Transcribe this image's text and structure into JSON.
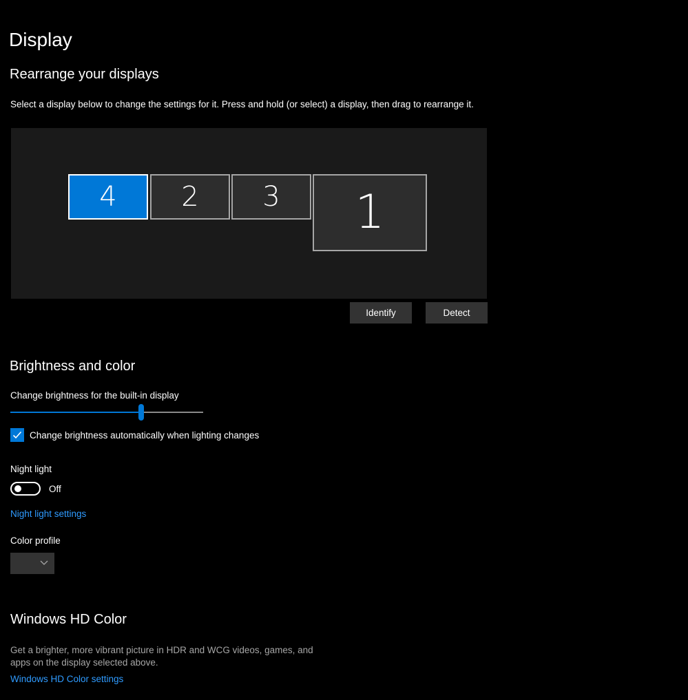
{
  "page_title": "Display",
  "rearrange": {
    "title": "Rearrange your displays",
    "description": "Select a display below to change the settings for it. Press and hold (or select) a display, then drag to rearrange it.",
    "monitors": [
      {
        "label": "4",
        "selected": true
      },
      {
        "label": "2",
        "selected": false
      },
      {
        "label": "3",
        "selected": false
      },
      {
        "label": "1",
        "selected": false
      }
    ],
    "identify_label": "Identify",
    "detect_label": "Detect"
  },
  "brightness": {
    "title": "Brightness and color",
    "slider_label": "Change brightness for the built-in display",
    "slider_value_percent": 68,
    "auto_checkbox_label": "Change brightness automatically when lighting changes",
    "auto_checked": true
  },
  "night_light": {
    "label": "Night light",
    "state": "Off",
    "settings_link": "Night light settings"
  },
  "color_profile": {
    "label": "Color profile",
    "selected_value": ""
  },
  "hdr": {
    "title": "Windows HD Color",
    "description": "Get a brighter, more vibrant picture in HDR and WCG videos, games, and apps on the display selected above.",
    "settings_link": "Windows HD Color settings"
  },
  "colors": {
    "accent": "#0078d7",
    "link": "#2f9bff",
    "background": "#000000",
    "arrange_area": "#1a1a1a",
    "button": "#333333"
  }
}
